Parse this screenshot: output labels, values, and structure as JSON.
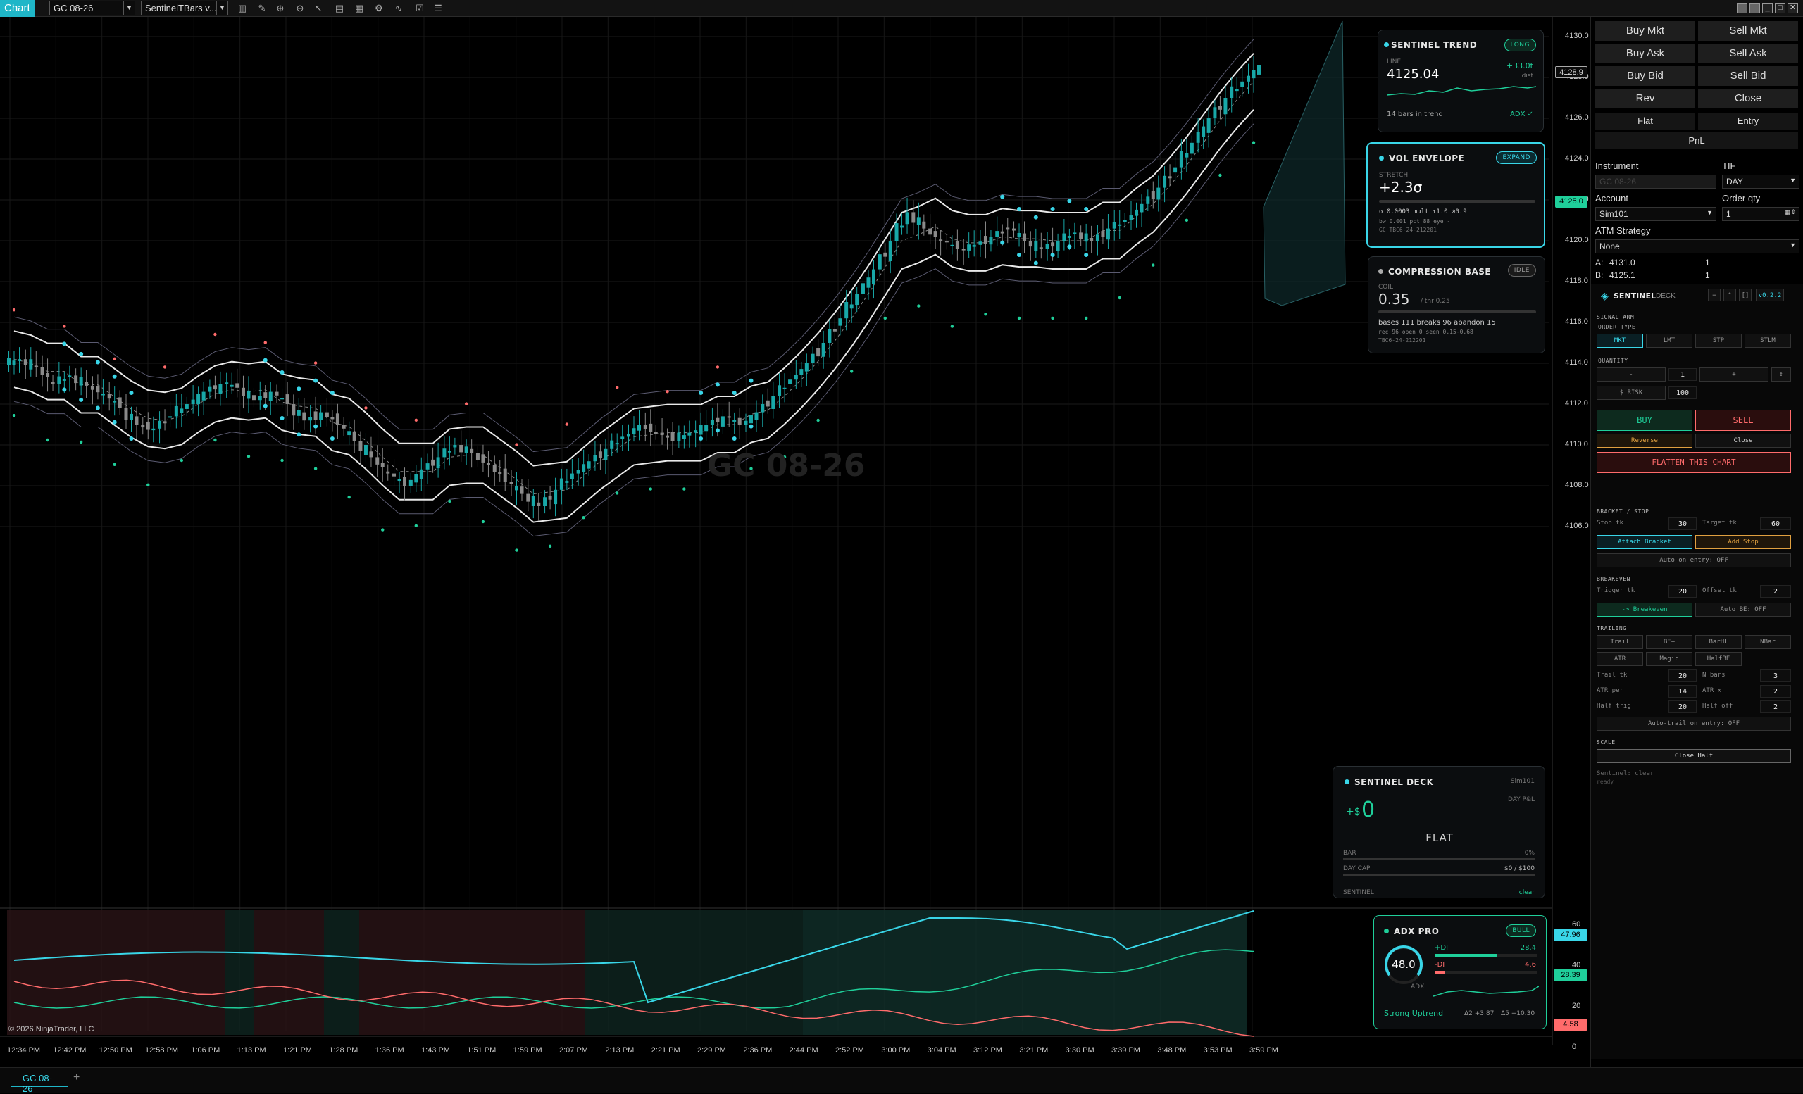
{
  "toolbar": {
    "chart_tab": "Chart",
    "instrument": "GC 08-26",
    "bar_type": "SentinelTBars v...",
    "icons": [
      "bar-type-icon",
      "draw-icon",
      "zoom-in-icon",
      "zoom-out-icon",
      "properties-icon",
      "template-icon",
      "data-box-icon",
      "strategies-icon",
      "indicators-icon",
      "attach-icon",
      "list-icon"
    ],
    "window_buttons": [
      "minimize-icon",
      "restore-icon",
      "maximize-icon",
      "close-icon"
    ]
  },
  "chart": {
    "watermark": "GC 08-26",
    "copyright": "© 2026 NinjaTrader, LLC",
    "bottom_tab": "GC 08-26",
    "add_tab": "+",
    "price_axis": [
      "4130.0",
      "4128.0",
      "4126.0",
      "4124.0",
      "4122.0",
      "4120.0",
      "4118.0",
      "4116.0",
      "4114.0",
      "4112.0",
      "4110.0",
      "4108.0",
      "4106.0"
    ],
    "price_tags": {
      "high": "4128.9",
      "last": "4125.0"
    },
    "time_axis": [
      "12:34 PM",
      "12:42 PM",
      "12:50 PM",
      "12:58 PM",
      "1:06 PM",
      "1:13 PM",
      "1:21 PM",
      "1:28 PM",
      "1:36 PM",
      "1:43 PM",
      "1:51 PM",
      "1:59 PM",
      "2:07 PM",
      "2:13 PM",
      "2:21 PM",
      "2:29 PM",
      "2:36 PM",
      "2:44 PM",
      "2:52 PM",
      "3:00 PM",
      "3:04 PM",
      "3:12 PM",
      "3:21 PM",
      "3:30 PM",
      "3:39 PM",
      "3:48 PM",
      "3:53 PM",
      "3:59 PM"
    ],
    "adx_axis": [
      "60",
      "40",
      "20",
      "0"
    ],
    "adx_tags": {
      "adx": "47.96",
      "plus_di": "28.39",
      "minus_di": "4.58"
    }
  },
  "colors": {
    "cyan": "#39d6e8",
    "teal": "#1fcf9a",
    "red": "#ff6b6b",
    "bull_candle": "#18a8a8",
    "bear_candle": "#8a8a8a"
  },
  "chart_data": {
    "type": "candlestick",
    "instrument": "GC 08-26",
    "close_path": [
      4114.2,
      4113.8,
      4113.0,
      4113.4,
      4112.9,
      4112.5,
      4111.8,
      4111.0,
      4110.8,
      4111.4,
      4112.0,
      4112.6,
      4113.0,
      4112.8,
      4112.2,
      4112.6,
      4112.0,
      4111.2,
      4111.6,
      4111.0,
      4110.2,
      4109.4,
      4108.6,
      4108.0,
      4108.8,
      4109.4,
      4110.0,
      4109.6,
      4109.0,
      4108.2,
      4107.6,
      4107.0,
      4107.8,
      4108.6,
      4109.2,
      4109.8,
      4110.4,
      4111.0,
      4110.6,
      4110.2,
      4110.6,
      4111.0,
      4111.4,
      4111.0,
      4111.6,
      4112.4,
      4113.2,
      4114.0,
      4115.0,
      4116.2,
      4117.4,
      4118.6,
      4120.0,
      4121.4,
      4120.6,
      4120.0,
      4119.6,
      4119.8,
      4120.2,
      4120.6,
      4120.0,
      4119.6,
      4120.0,
      4120.4,
      4120.0,
      4120.6,
      4121.0,
      4121.8,
      4122.6,
      4123.6,
      4124.8,
      4126.0,
      4127.0,
      4127.8,
      4128.6
    ],
    "x_range": [
      "12:34 PM",
      "3:59 PM"
    ],
    "ylim": [
      4105.0,
      4130.5
    ],
    "adx_series": [
      {
        "name": "ADX",
        "last": 47.96
      },
      {
        "name": "+DI",
        "last": 28.39
      },
      {
        "name": "-DI",
        "last": 4.58
      }
    ],
    "adx_ylim": [
      0,
      60
    ]
  },
  "sentinel_trend": {
    "title": "SENTINEL TREND",
    "badge": "LONG",
    "sub": "LINE",
    "value": "4125.04",
    "delta": "+33.0t",
    "delta_unit": "dist",
    "footer": "14 bars in trend",
    "adx": "ADX ✓"
  },
  "vol_envelope": {
    "title": "VOL ENVELOPE",
    "badge": "EXPAND",
    "sub": "STRETCH",
    "value": "+2.3σ",
    "line1": "σ 0.0003   mult ↑1.0 ⊙0.9",
    "line2": "bw 0.001  pct 88   eye -",
    "line3": "GC  TBC6-24-212201"
  },
  "compression": {
    "title": "COMPRESSION BASE",
    "badge": "IDLE",
    "sub": "COIL",
    "value": "0.35",
    "thr": "/ thr 0.25",
    "line1": "bases 111   breaks 96   abandon 15",
    "line2": "rec 96   open 0   seen 0.15-0.68",
    "line3": "TBC6-24-212201"
  },
  "deck_card": {
    "title": "SENTINEL DECK",
    "account": "Sim101",
    "pnl_label": "DAY P&L",
    "pnl_prefix": "+$",
    "pnl": "0",
    "state": "FLAT",
    "bar_label": "BAR",
    "bar_val": "0%",
    "cap_label": "DAY CAP",
    "cap_val": "$0 / $100",
    "footer_left": "SENTINEL",
    "footer_right": "clear"
  },
  "adx_card": {
    "title": "ADX PRO",
    "badge": "BULL",
    "value": "48.0",
    "label": "ADX",
    "pdi_label": "+DI",
    "pdi": "28.4",
    "mdi_label": "-DI",
    "mdi": "4.6",
    "status": "Strong Uptrend",
    "delta1": "Δ2 +3.87",
    "delta2": "Δ5 +10.30"
  },
  "order_panel": {
    "buttons": [
      "Buy Mkt",
      "Sell Mkt",
      "Buy Ask",
      "Sell Ask",
      "Buy Bid",
      "Sell Bid",
      "Rev",
      "Close"
    ],
    "flat": "Flat",
    "entry": "Entry",
    "pnl": "PnL",
    "instrument_label": "Instrument",
    "instrument_val": "GC 08-26",
    "tif_label": "TIF",
    "tif_val": "DAY",
    "account_label": "Account",
    "account_val": "Sim101",
    "qty_label": "Order qty",
    "qty_val": "1",
    "atm_label": "ATM Strategy",
    "atm_val": "None",
    "ask_label": "A:",
    "ask_val": "4131.0",
    "ask_qty": "1",
    "bid_label": "B:",
    "bid_val": "4125.1",
    "bid_qty": "1"
  },
  "deck": {
    "title": "SENTINEL",
    "subtitle": "DECK",
    "version": "v0.2.2",
    "ctrl": [
      "−",
      "^",
      "[]"
    ],
    "signal_arm": "SIGNAL ARM",
    "order_type": "ORDER TYPE",
    "types": [
      "MKT",
      "LMT",
      "STP",
      "STLM"
    ],
    "quantity": "QUANTITY",
    "qty_minus": "-",
    "qty": "1",
    "qty_plus": "+",
    "qty_x": "↕",
    "risk_label": "$ RISK",
    "risk_val": "100",
    "buy": "BUY",
    "sell": "SELL",
    "reverse": "Reverse",
    "close": "Close",
    "flatten": "FLATTEN THIS CHART",
    "bracket": "BRACKET / STOP",
    "stop_label": "Stop tk",
    "stop_val": "30",
    "target_label": "Target tk",
    "target_val": "60",
    "attach": "Attach Bracket",
    "add_stop": "Add Stop",
    "auto_entry": "Auto on entry: OFF",
    "breakeven": "BREAKEVEN",
    "trig_label": "Trigger tk",
    "trig_val": "20",
    "off_label": "Offset tk",
    "off_val": "2",
    "be_btn": "-> Breakeven",
    "auto_be": "Auto BE: OFF",
    "trailing": "TRAILING",
    "trail_btns": [
      "Trail",
      "BE+",
      "BarHL",
      "NBar",
      "ATR",
      "Magic",
      "HalfBE"
    ],
    "trail_tk_label": "Trail tk",
    "trail_tk": "20",
    "nbars_label": "N bars",
    "nbars": "3",
    "atr_per_label": "ATR per",
    "atr_per": "14",
    "atr_x_label": "ATR x",
    "atr_x": "2",
    "half_trig_label": "Half trig",
    "half_trig": "20",
    "half_off_label": "Half off",
    "half_off": "2",
    "auto_trail": "Auto-trail on entry: OFF",
    "scale": "SCALE",
    "close_half": "Close Half",
    "status1": "Sentinel: clear",
    "status2": "ready"
  }
}
